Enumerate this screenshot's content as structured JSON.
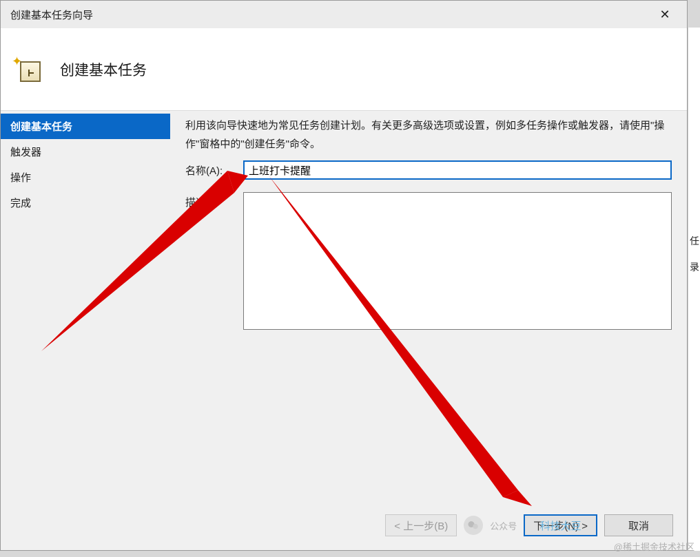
{
  "titlebar": {
    "title": "创建基本任务向导"
  },
  "header": {
    "title": "创建基本任务"
  },
  "sidebar": {
    "items": [
      {
        "label": "创建基本任务",
        "active": true
      },
      {
        "label": "触发器",
        "active": false
      },
      {
        "label": "操作",
        "active": false
      },
      {
        "label": "完成",
        "active": false
      }
    ]
  },
  "content": {
    "instruction": "利用该向导快速地为常见任务创建计划。有关更多高级选项或设置，例如多任务操作或触发器，请使用\"操作\"窗格中的\"创建任务\"命令。",
    "name_label": "名称(A):",
    "name_value": "上班打卡提醒",
    "desc_label": "描述",
    "desc_value": ""
  },
  "buttons": {
    "back": "< 上一步(B)",
    "next": "下一步(N) >",
    "cancel": "取消"
  },
  "outer": {
    "t1": "任",
    "t2": "录"
  },
  "watermark": {
    "text": "@稀土掘金技术社区",
    "brand": "科技大豆",
    "prefix": "公众号"
  }
}
